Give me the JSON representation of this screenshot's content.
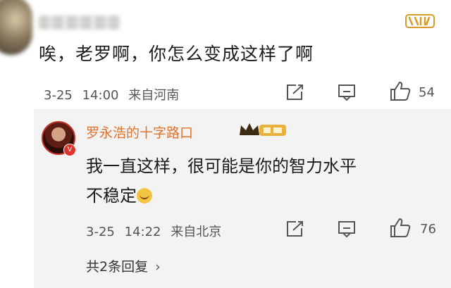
{
  "comment": {
    "username": "",
    "badge": "top-comment-badge",
    "text": "唉，老罗啊，你怎么变成这样了啊",
    "date": "3-25",
    "time": "14:00",
    "source": "来自河南",
    "likes": "54"
  },
  "reply": {
    "username": "罗永浩的十字路口",
    "badge_icon": "crown-icon",
    "text_line1": "我一直这样，很可能是你的智力水平",
    "text_line2": "不稳定",
    "emoji": "smile-emoji-icon",
    "date": "3-25",
    "time": "14:22",
    "source": "来自北京",
    "likes": "76"
  },
  "footer": {
    "total_replies": "共2条回复"
  },
  "colors": {
    "username_orange": "#e0732b",
    "badge_gold": "#d89a28",
    "reply_background": "#f3f3f3"
  }
}
